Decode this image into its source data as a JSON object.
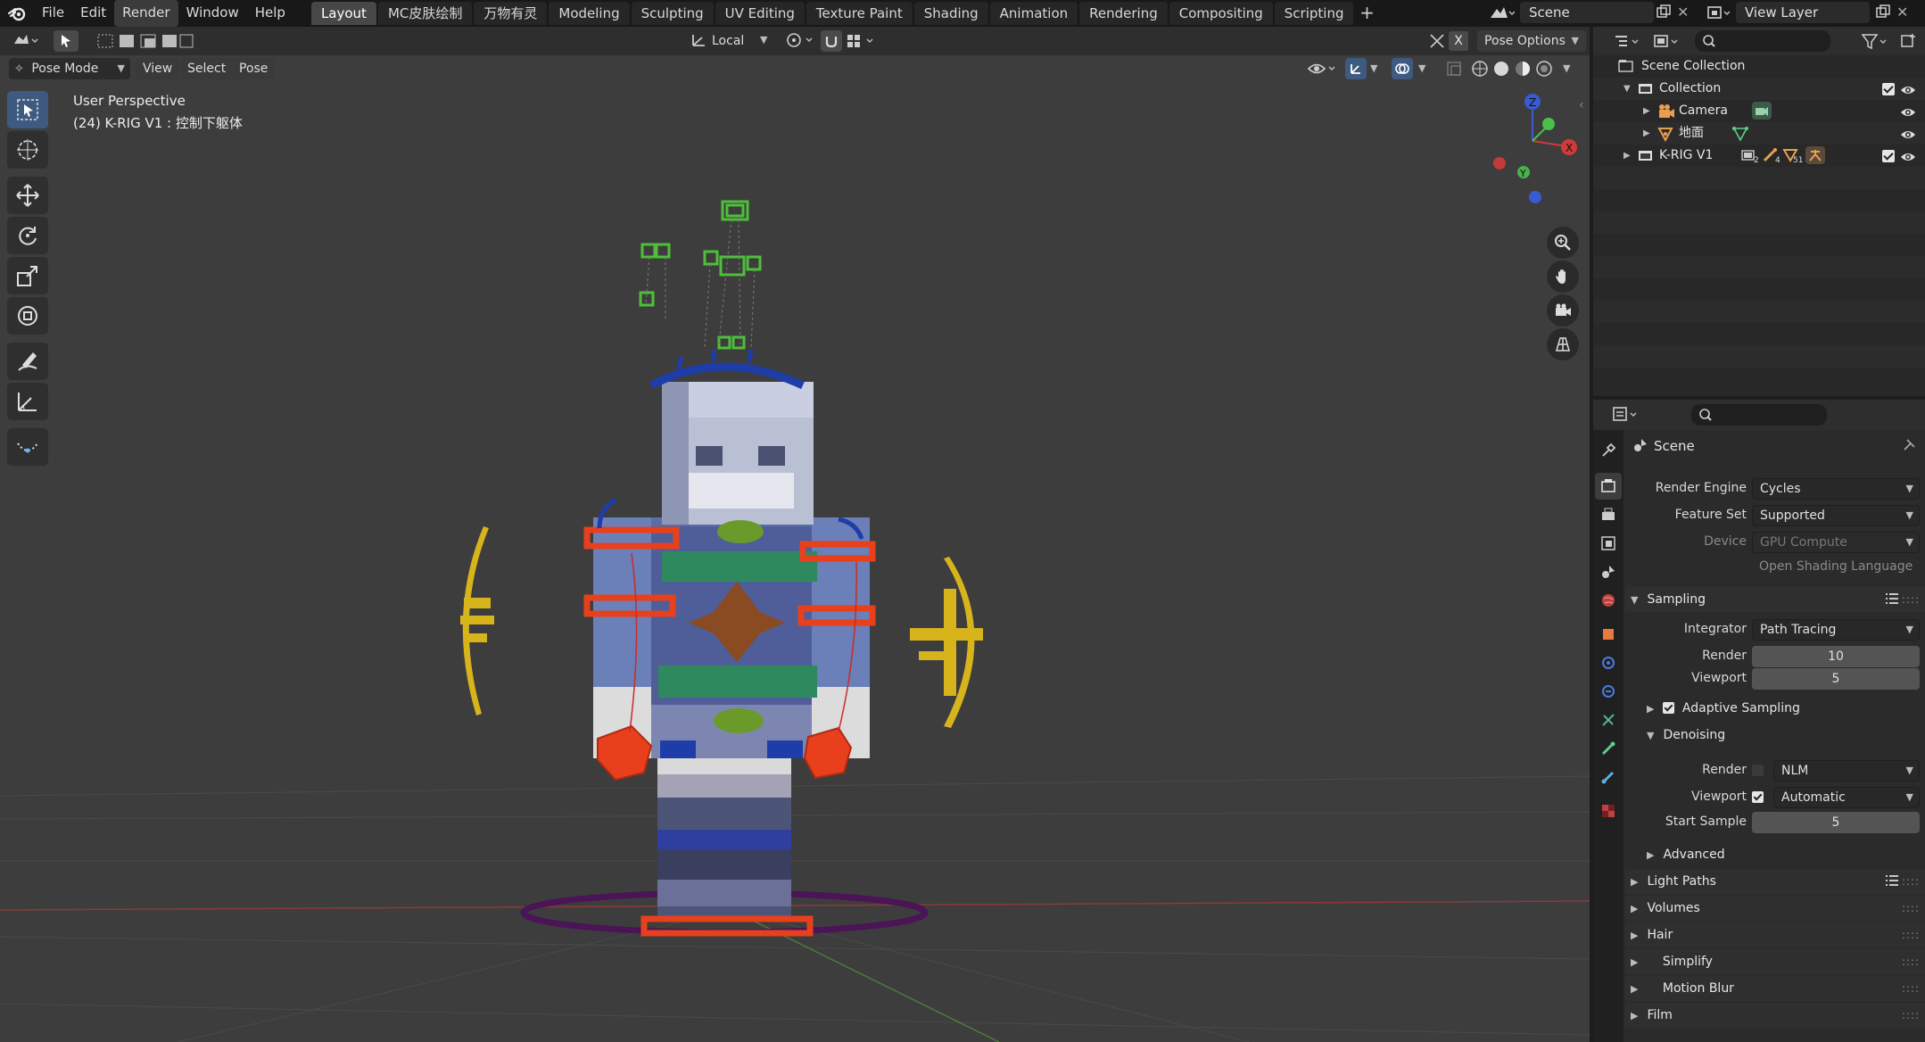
{
  "menu": {
    "items": [
      "File",
      "Edit",
      "Render",
      "Window",
      "Help"
    ],
    "active": "Render"
  },
  "workspaces": [
    "Layout",
    "MC皮肤绘制",
    "万物有灵",
    "Modeling",
    "Sculpting",
    "UV Editing",
    "Texture Paint",
    "Shading",
    "Animation",
    "Rendering",
    "Compositing",
    "Scripting"
  ],
  "active_workspace": "Layout",
  "scene_name": "Scene",
  "view_layer": "View Layer",
  "viewport": {
    "mode": "Pose Mode",
    "menus": [
      "View",
      "Select",
      "Pose"
    ],
    "orientation": "Local",
    "pose_options": "Pose Options",
    "perspective": "User Perspective",
    "active_info": "(24) K-RIG V1 : 控制下躯体",
    "gizmo_axes": [
      "X",
      "Y",
      "Z"
    ],
    "pose_options_badge": "X"
  },
  "outliner": {
    "rows": [
      {
        "label": "Scene Collection",
        "icon": "scene-collection-icon",
        "indent": 0
      },
      {
        "label": "Collection",
        "icon": "collection-icon",
        "indent": 1,
        "checked": true
      },
      {
        "label": "Camera",
        "icon": "camera-icon",
        "indent": 2
      },
      {
        "label": "地面",
        "icon": "mesh-icon",
        "indent": 2
      },
      {
        "label": "K-RIG V1",
        "icon": "collection-icon",
        "indent": 1,
        "checked": true,
        "counts": [
          "2",
          "4",
          "51"
        ]
      }
    ]
  },
  "properties": {
    "context": "Scene",
    "render_engine_label": "Render Engine",
    "render_engine": "Cycles",
    "feature_set_label": "Feature Set",
    "feature_set": "Supported",
    "device_label": "Device",
    "device": "GPU Compute",
    "osl_label": "Open Shading Language",
    "sampling": {
      "title": "Sampling",
      "integrator_label": "Integrator",
      "integrator": "Path Tracing",
      "render_label": "Render",
      "render": "10",
      "viewport_label": "Viewport",
      "viewport": "5",
      "adaptive": "Adaptive Sampling",
      "denoising": "Denoising",
      "den_render_label": "Render",
      "den_render": "NLM",
      "den_viewport_label": "Viewport",
      "den_viewport": "Automatic",
      "start_sample_label": "Start Sample",
      "start_sample": "5",
      "advanced": "Advanced"
    },
    "panels": [
      "Light Paths",
      "Volumes",
      "Hair",
      "Simplify",
      "Motion Blur",
      "Film"
    ]
  },
  "colors": {
    "accent": "#4772b3",
    "active_tool": "#3f5a80",
    "bone_red": "#e8401c",
    "bone_yellow": "#d8b41c",
    "bone_green": "#2e8a5e",
    "bone_blue": "#1f3da8",
    "ground_ring": "#5a1a6a"
  }
}
